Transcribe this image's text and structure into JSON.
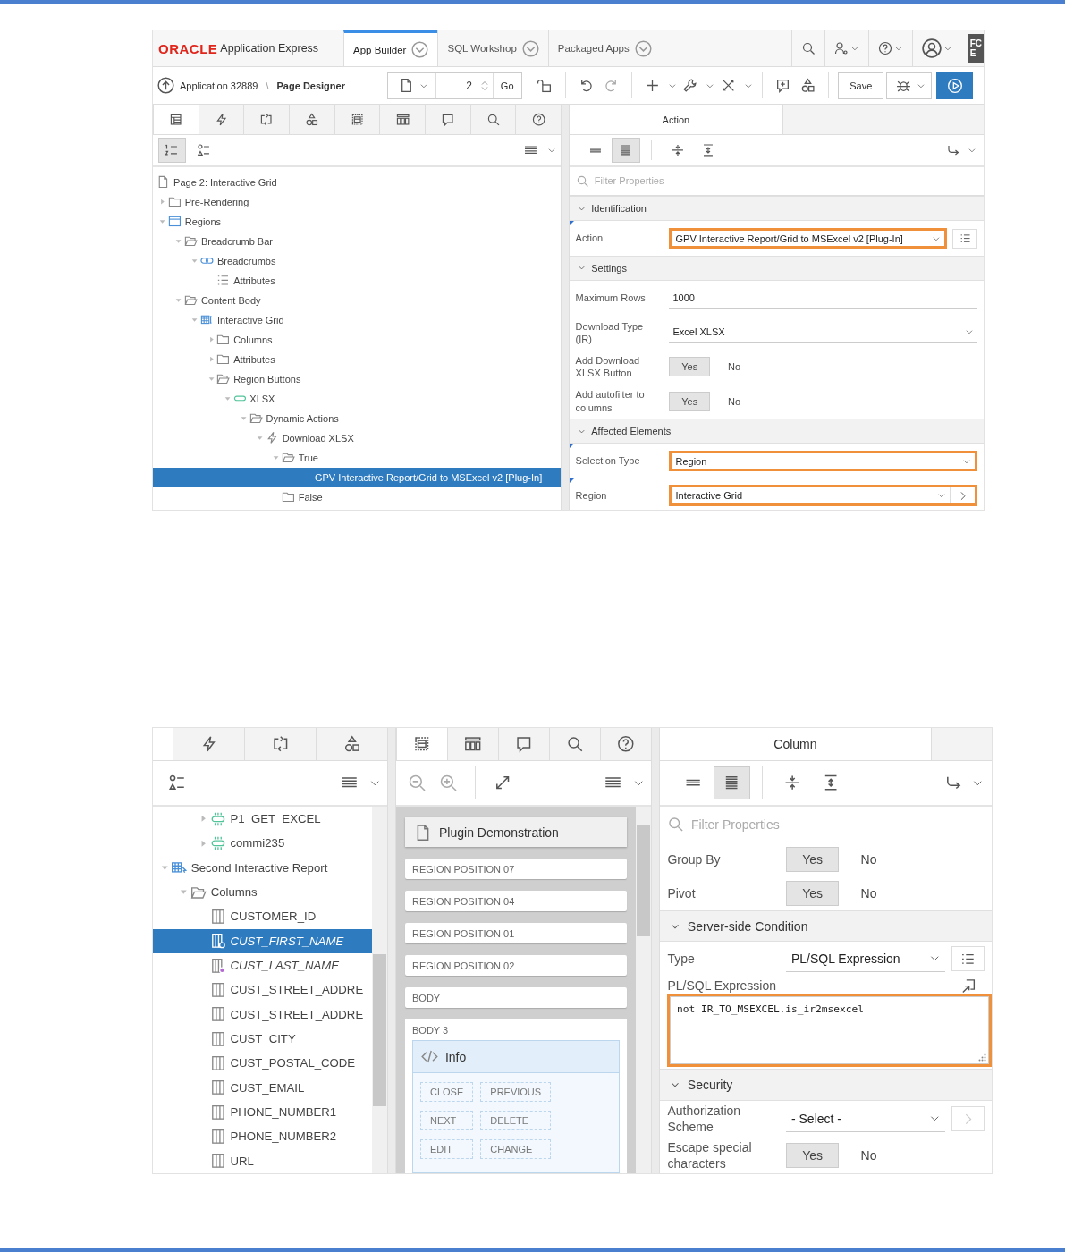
{
  "page_one": {
    "header": {
      "brand": "ORACLE",
      "product": "Application Express",
      "tabs": [
        {
          "label": "App Builder",
          "selected": true
        },
        {
          "label": "SQL Workshop",
          "selected": false
        },
        {
          "label": "Packaged Apps",
          "selected": false
        }
      ],
      "cut_logo": [
        "FC",
        "E"
      ]
    },
    "toolbar": {
      "application": "Application 32889",
      "separator": "\\",
      "page_designer": "Page Designer",
      "page_number": "2",
      "go": "Go",
      "save": "Save"
    },
    "left_tabs": [
      {
        "kind": "rendering",
        "selected": true
      },
      {
        "kind": "dynamic-actions",
        "selected": false
      },
      {
        "kind": "processing",
        "selected": false
      },
      {
        "kind": "shared",
        "selected": false
      },
      {
        "kind": "layout",
        "selected": false
      },
      {
        "kind": "gallery",
        "selected": false
      },
      {
        "kind": "comments",
        "selected": false
      },
      {
        "kind": "search",
        "selected": false
      },
      {
        "kind": "help",
        "selected": false
      }
    ],
    "view_buttons": [
      {
        "kind": "numbered",
        "selected": true
      },
      {
        "kind": "shapes-list",
        "selected": false
      }
    ],
    "tree": [
      {
        "label": "Page 2: Interactive Grid",
        "kind": "page",
        "selected": false
      },
      {
        "label": "Pre-Rendering",
        "kind": "folder",
        "expanded": false,
        "selected": false
      },
      {
        "label": "Regions",
        "kind": "region",
        "expanded": true,
        "selected": false,
        "children": [
          {
            "label": "Breadcrumb Bar",
            "kind": "folder-open",
            "expanded": true,
            "selected": false,
            "children": [
              {
                "label": "Breadcrumbs",
                "kind": "breadcrumb",
                "expanded": true,
                "selected": false,
                "children": [
                  {
                    "label": "Attributes",
                    "kind": "list",
                    "selected": false
                  }
                ]
              }
            ]
          },
          {
            "label": "Content Body",
            "kind": "folder-open",
            "expanded": true,
            "selected": false,
            "children": [
              {
                "label": "Interactive Grid",
                "kind": "grid",
                "expanded": true,
                "selected": false,
                "children": [
                  {
                    "label": "Columns",
                    "kind": "folder",
                    "expanded": false,
                    "selected": false
                  },
                  {
                    "label": "Attributes",
                    "kind": "folder",
                    "expanded": false,
                    "selected": false
                  },
                  {
                    "label": "Region Buttons",
                    "kind": "folder-open",
                    "expanded": true,
                    "selected": false,
                    "children": [
                      {
                        "label": "XLSX",
                        "kind": "button",
                        "expanded": true,
                        "selected": false,
                        "children": [
                          {
                            "label": "Dynamic Actions",
                            "kind": "folder-open",
                            "expanded": true,
                            "selected": false,
                            "children": [
                              {
                                "label": "Download XLSX",
                                "kind": "lightning",
                                "expanded": true,
                                "selected": false,
                                "children": [
                                  {
                                    "label": "True",
                                    "kind": "folder-open",
                                    "expanded": true,
                                    "selected": false,
                                    "children": [
                                      {
                                        "label": "GPV Interactive Report/Grid to MSExcel v2 [Plug-In]",
                                        "kind": "action",
                                        "selected": true
                                      }
                                    ]
                                  },
                                  {
                                    "label": "False",
                                    "kind": "folder",
                                    "selected": false
                                  }
                                ]
                              }
                            ]
                          }
                        ]
                      }
                    ]
                  }
                ]
              }
            ]
          }
        ]
      }
    ],
    "property_editor": {
      "tab": "Action",
      "toolbar": [
        {
          "kind": "collapse-lines",
          "selected": false
        },
        {
          "kind": "expand-lines",
          "selected": true
        },
        {
          "kind": "collapse-all",
          "selected": false
        },
        {
          "kind": "expand-all",
          "selected": false
        }
      ],
      "filter_placeholder": "Filter Properties",
      "sections": [
        {
          "title": "Identification",
          "expanded": true,
          "rows": [
            {
              "kind": "select",
              "label": "Action",
              "value": "GPV Interactive Report/Grid to MSExcel v2 [Plug-In]",
              "required": true,
              "highlighted": true,
              "side_button": {
                "kind": "list"
              }
            }
          ]
        },
        {
          "title": "Settings",
          "expanded": true,
          "rows": [
            {
              "kind": "text",
              "label": "Maximum Rows",
              "value": "1000",
              "required": false,
              "highlighted": false
            },
            {
              "kind": "select",
              "label": "Download Type (IR)",
              "value": "Excel XLSX",
              "required": false,
              "highlighted": false
            },
            {
              "kind": "switch",
              "label": "Add Download XLSX Button",
              "required": false,
              "highlighted": false,
              "options": [
                {
                  "label": "Yes",
                  "selected": true
                },
                {
                  "label": "No",
                  "selected": false
                }
              ]
            },
            {
              "kind": "switch",
              "label": "Add autofilter to columns",
              "required": false,
              "highlighted": false,
              "options": [
                {
                  "label": "Yes",
                  "selected": true
                },
                {
                  "label": "No",
                  "selected": false
                }
              ]
            }
          ]
        },
        {
          "title": "Affected Elements",
          "expanded": true,
          "rows": [
            {
              "kind": "select",
              "label": "Selection Type",
              "value": "Region",
              "required": true,
              "highlighted": true
            },
            {
              "kind": "select",
              "label": "Region",
              "value": "Interactive Grid",
              "required": true,
              "highlighted": true,
              "side_button": {
                "kind": "link",
                "disabled": false
              }
            }
          ]
        }
      ]
    }
  },
  "page_two": {
    "left_tabs": [
      {
        "kind": "dynamic-actions",
        "selected": false
      },
      {
        "kind": "processing",
        "selected": false
      },
      {
        "kind": "shared",
        "selected": false
      }
    ],
    "view_buttons": [
      {
        "kind": "shapes-list",
        "selected": false
      }
    ],
    "tree": [
      {
        "children": [
          {
            "children": [
              {
                "label": "P1_GET_EXCEL",
                "kind": "item",
                "expanded": false,
                "selected": false
              },
              {
                "label": "commi235",
                "kind": "item",
                "expanded": false,
                "selected": false
              }
            ]
          }
        ]
      },
      {
        "label": "Second Interactive Report",
        "kind": "report",
        "expanded": true,
        "selected": false,
        "children": [
          {
            "label": "Columns",
            "kind": "folder-open",
            "expanded": true,
            "selected": false,
            "children": [
              {
                "label": "CUSTOMER_ID",
                "kind": "column",
                "selected": false
              },
              {
                "label": "CUST_FIRST_NAME",
                "kind": "column-marked",
                "selected": true
              },
              {
                "label": "CUST_LAST_NAME",
                "kind": "column-marked",
                "selected": false
              },
              {
                "label": "CUST_STREET_ADDRE",
                "kind": "column",
                "selected": false
              },
              {
                "label": "CUST_STREET_ADDRE",
                "kind": "column",
                "selected": false
              },
              {
                "label": "CUST_CITY",
                "kind": "column",
                "selected": false
              },
              {
                "label": "CUST_POSTAL_CODE",
                "kind": "column",
                "selected": false
              },
              {
                "label": "CUST_EMAIL",
                "kind": "column",
                "selected": false
              },
              {
                "label": "PHONE_NUMBER1",
                "kind": "column",
                "selected": false
              },
              {
                "label": "PHONE_NUMBER2",
                "kind": "column",
                "selected": false
              },
              {
                "label": "URL",
                "kind": "column",
                "selected": false
              }
            ]
          }
        ]
      }
    ],
    "layout_tabs": [
      {
        "kind": "layout",
        "selected": true
      },
      {
        "kind": "gallery",
        "selected": false
      },
      {
        "kind": "comments",
        "selected": false
      },
      {
        "kind": "search",
        "selected": false
      },
      {
        "kind": "help",
        "selected": false
      }
    ],
    "layout": {
      "page_title": "Plugin Demonstration",
      "positions": [
        "REGION POSITION 07",
        "REGION POSITION 04",
        "REGION POSITION 01",
        "REGION POSITION 02",
        "BODY"
      ],
      "body": {
        "label": "BODY 3",
        "region": {
          "title": "Info",
          "buttons": [
            "CLOSE",
            "PREVIOUS",
            "NEXT",
            "DELETE",
            "EDIT",
            "CHANGE"
          ]
        }
      }
    },
    "property_editor": {
      "tab": "Column",
      "toolbar": [
        {
          "kind": "collapse-lines",
          "selected": false
        },
        {
          "kind": "expand-lines",
          "selected": true
        },
        {
          "kind": "collapse-all",
          "selected": false
        },
        {
          "kind": "expand-all",
          "selected": false
        }
      ],
      "filter_placeholder": "Filter Properties",
      "sections": [
        {
          "rows": [
            {
              "kind": "switch",
              "label": "Group By",
              "required": false,
              "highlighted": false,
              "options": [
                {
                  "label": "Yes",
                  "selected": true
                },
                {
                  "label": "No",
                  "selected": false
                }
              ]
            },
            {
              "kind": "switch",
              "label": "Pivot",
              "required": false,
              "highlighted": false,
              "options": [
                {
                  "label": "Yes",
                  "selected": true
                },
                {
                  "label": "No",
                  "selected": false
                }
              ]
            }
          ]
        },
        {
          "title": "Server-side Condition",
          "expanded": true,
          "rows": [
            {
              "kind": "select",
              "label": "Type",
              "value": "PL/SQL Expression",
              "required": false,
              "highlighted": false,
              "side_button": {
                "kind": "list"
              }
            },
            {
              "kind": "code",
              "label": "PL/SQL Expression",
              "value": "not IR_TO_MSEXCEL.is_ir2msexcel",
              "required": false,
              "highlighted": true
            }
          ]
        },
        {
          "title": "Security",
          "expanded": true,
          "rows": [
            {
              "kind": "select",
              "label": "Authorization Scheme",
              "value": "- Select -",
              "required": false,
              "highlighted": false,
              "side_button": {
                "kind": "link",
                "disabled": true
              }
            },
            {
              "kind": "switch",
              "label": "Escape special characters",
              "required": false,
              "highlighted": false,
              "options": [
                {
                  "label": "Yes",
                  "selected": true
                },
                {
                  "label": "No",
                  "selected": false
                }
              ]
            }
          ]
        }
      ]
    }
  }
}
